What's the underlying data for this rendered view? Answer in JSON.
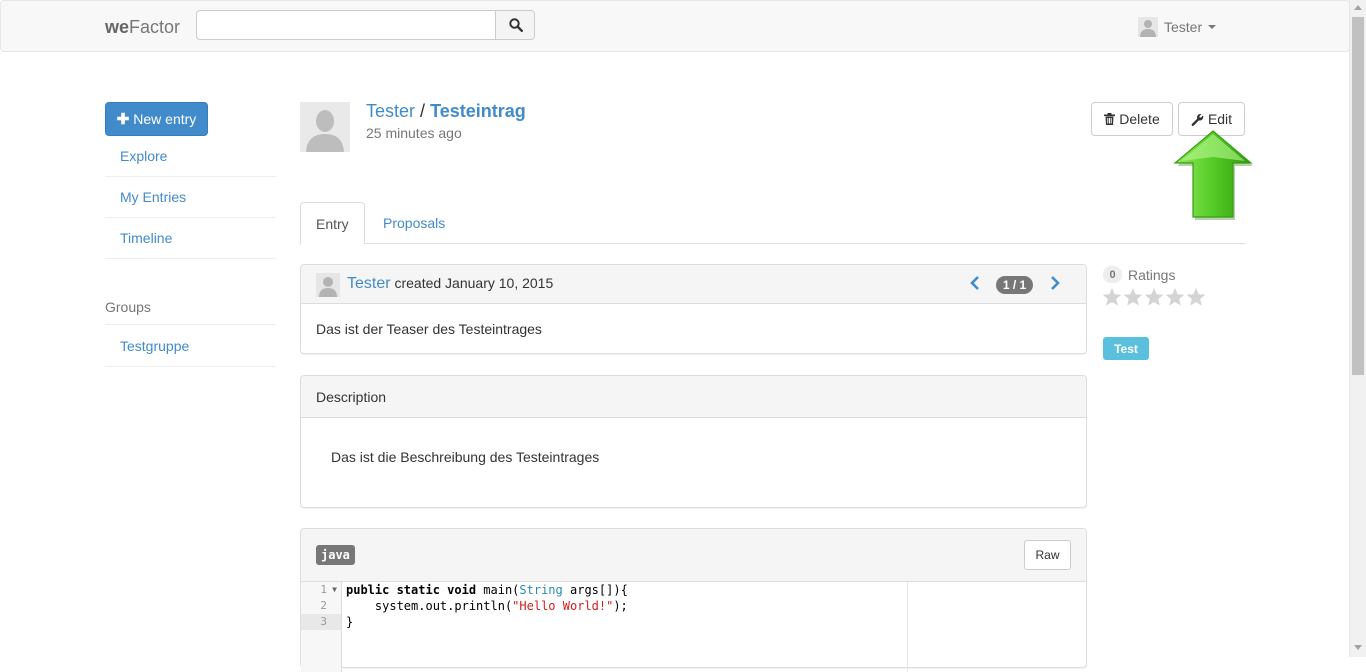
{
  "navbar": {
    "brand_bold": "we",
    "brand_rest": "Factor",
    "search_placeholder": "",
    "search_icon": "search-icon",
    "user_name": "Tester"
  },
  "sidebar": {
    "new_entry_label": "New entry",
    "items": [
      {
        "label": "Explore"
      },
      {
        "label": "My Entries"
      },
      {
        "label": "Timeline"
      }
    ],
    "groups_heading": "Groups",
    "groups": [
      {
        "label": "Testgruppe"
      }
    ]
  },
  "entry": {
    "author": "Tester",
    "separator": "/",
    "title": "Testeintrag",
    "time_ago": "25 minutes ago",
    "delete_label": "Delete",
    "edit_label": "Edit"
  },
  "tabs": [
    {
      "label": "Entry",
      "active": true
    },
    {
      "label": "Proposals",
      "active": false
    }
  ],
  "teaser_panel": {
    "creator": "Tester",
    "created_text": "created January 10, 2015",
    "version": "1 / 1",
    "teaser": "Das ist der Teaser des Testeintrages"
  },
  "description_panel": {
    "heading": "Description",
    "text": "Das ist die Beschreibung des Testeintrages"
  },
  "code_panel": {
    "language": "java",
    "raw_label": "Raw",
    "line_numbers": [
      "1",
      "2",
      "3"
    ],
    "lines": [
      "public static void main(String args[]){",
      "    system.out.println(\"Hello World!\");",
      "}"
    ]
  },
  "sidebar_right": {
    "rating_count": "0",
    "ratings_label": "Ratings",
    "stars_filled": 0,
    "stars_total": 5,
    "tag": "Test"
  },
  "colors": {
    "primary": "#428bca",
    "info": "#5bc0de",
    "arrow_green": "#4cc71e"
  }
}
